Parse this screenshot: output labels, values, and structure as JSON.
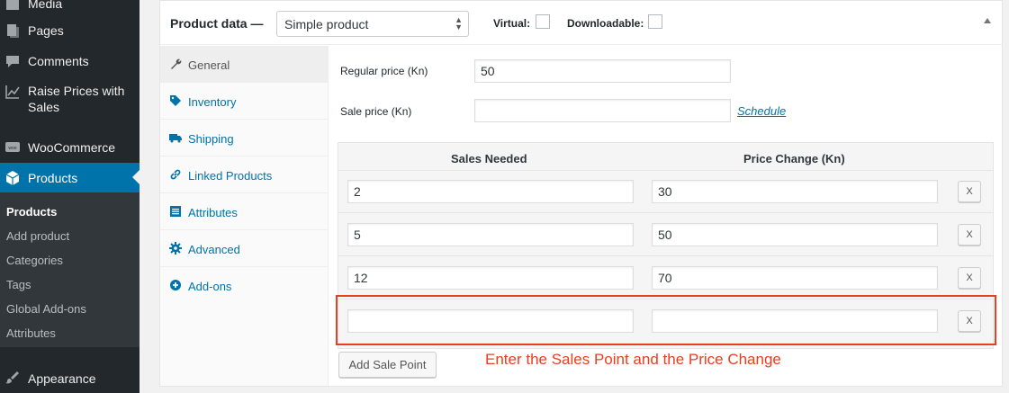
{
  "sidebar": {
    "menu": [
      {
        "label": "Media",
        "icon": "media-icon"
      },
      {
        "label": "Pages",
        "icon": "pages-icon"
      },
      {
        "label": "Comments",
        "icon": "comments-icon"
      },
      {
        "label": "Raise Prices with Sales",
        "icon": "chart-line-icon"
      },
      {
        "label": "WooCommerce",
        "icon": "woocommerce-icon"
      },
      {
        "label": "Products",
        "icon": "products-box-icon"
      },
      {
        "label": "Appearance",
        "icon": "paintbrush-icon"
      }
    ],
    "submenu": [
      "Products",
      "Add product",
      "Categories",
      "Tags",
      "Global Add-ons",
      "Attributes"
    ]
  },
  "product_data": {
    "title": "Product data —",
    "type_select": "Simple product",
    "virtual_label": "Virtual:",
    "downloadable_label": "Downloadable:",
    "tabs": [
      {
        "label": "General",
        "icon": "wrench-icon"
      },
      {
        "label": "Inventory",
        "icon": "tag-icon"
      },
      {
        "label": "Shipping",
        "icon": "truck-icon"
      },
      {
        "label": "Linked Products",
        "icon": "link-icon"
      },
      {
        "label": "Attributes",
        "icon": "list-icon"
      },
      {
        "label": "Advanced",
        "icon": "gear-icon"
      },
      {
        "label": "Add-ons",
        "icon": "plus-circle-icon"
      }
    ],
    "regular_price_label": "Regular price (Kn)",
    "regular_price_value": "50",
    "sale_price_label": "Sale price (Kn)",
    "sale_price_value": "",
    "schedule_link": "Schedule"
  },
  "sales_table": {
    "col_sales_needed": "Sales Needed",
    "col_price_change": "Price Change (Kn)",
    "remove_label": "X",
    "rows": [
      {
        "sales": "2",
        "price": "30"
      },
      {
        "sales": "5",
        "price": "50"
      },
      {
        "sales": "12",
        "price": "70"
      },
      {
        "sales": "",
        "price": ""
      }
    ],
    "add_button": "Add Sale Point"
  },
  "annotation": {
    "text": "Enter the Sales Point and the Price Change",
    "color": "#e8401c"
  },
  "colors": {
    "sidebar_bg": "#23282d",
    "accent": "#0073aa"
  }
}
